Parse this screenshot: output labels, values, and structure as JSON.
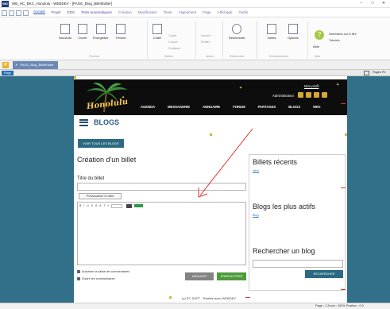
{
  "window": {
    "app_logo": "WD",
    "title": "WB_HC_BKC_Honolulu - WEBDEV - [PAGE_Blog_BilletEditer]",
    "controls": [
      "–",
      "□",
      "✕"
    ]
  },
  "menu": {
    "items": [
      {
        "label": "Accueil",
        "active": true
      },
      {
        "label": "Projet"
      },
      {
        "label": "GDS"
      },
      {
        "label": "Tests automatiques"
      },
      {
        "label": "Création",
        "muted": true
      },
      {
        "label": "Modification",
        "muted": true
      },
      {
        "label": "Texte",
        "muted": true
      },
      {
        "label": "Alignement",
        "muted": true
      },
      {
        "label": "Page",
        "muted": true
      },
      {
        "label": "Affichage",
        "muted": true
      },
      {
        "label": "Outils",
        "muted": true
      }
    ]
  },
  "ribbon": {
    "buttons": [
      "Nouveau",
      "Ouvrir",
      "Enregistrer",
      "Fermer",
      "Coller",
      "Rechercher",
      "Volets",
      "Options",
      "Aide"
    ],
    "small": {
      "copier": "Copier",
      "couper": "Couper",
      "dupliquer": "Dupliquer",
      "annuler": "Annuler",
      "refaire": "Refaire",
      "info_title": "Information sur le titre",
      "tutoriels": "Tutoriels"
    },
    "groups": [
      "Général",
      "Edition",
      "Action",
      "Rechercher",
      "Environnement",
      "Aide"
    ]
  },
  "tabs": {
    "page_logo": "P",
    "document_tab": "PAGE_Blog_BilletEditer",
    "close": "✕"
  },
  "subbar": {
    "page_label": "Page",
    "side_label": "Pages Pe"
  },
  "site": {
    "logo": "Honolulu",
    "nav": [
      "AGENDA",
      "MESSAGERIE",
      "ANNUAIRE",
      "FORUM",
      "PARTAGES",
      "BLOGS",
      "WIKI"
    ],
    "profile_link": "Mon profil",
    "admin_label": "Administrateur"
  },
  "blogs": {
    "section_title": "BLOGS",
    "view_all": "VOIR TOUS LES BLOGS"
  },
  "form": {
    "title": "Création d'un billet",
    "titre_label": "Titre du billet",
    "preview_btn": "Prévisualiser le billet",
    "toolbar": [
      "B",
      "I",
      "U",
      "S",
      "A",
      "A",
      "T",
      "≡"
    ],
    "chk_comments": "Autoriser la saisie de commentaires",
    "chk_follow": "Suivre les commentaires",
    "cancel": "ANNULER",
    "save": "ENREGISTRER"
  },
  "sidebar": {
    "recent_title": "Billets récents",
    "recent_link": "label",
    "active_title": "Blogs les plus actifs",
    "active_link": "Blog",
    "search_title": "Rechercher un blog",
    "search_btn": "RECHERCHER"
  },
  "footer": {
    "text": "(c) PC SOFT - Réalisé avec WEBDEV"
  },
  "status": {
    "text": "Page : 1  Zoom : 100%  Position : 0,0"
  }
}
